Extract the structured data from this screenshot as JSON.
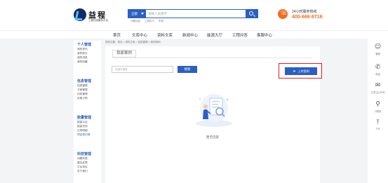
{
  "header": {
    "logo_name": "益程",
    "logo_sub": "工程在线服务平台",
    "search_select": "全部",
    "search_placeholder": "请输入关键字",
    "hotwords": [
      "问题回复",
      "工程执行",
      "申报"
    ],
    "hotline_label": "24小时服务热线",
    "hotline_number": "400-666-9716"
  },
  "nav": [
    "首页",
    "文库中心",
    "资料文库",
    "新闻中心",
    "能源大厅",
    "工程问答",
    "客服中心"
  ],
  "sidebar": {
    "groups": [
      {
        "title": "个人管理",
        "items": [
          "我的资讯",
          "我的积分",
          "我的消息",
          "我的收藏"
        ]
      },
      {
        "title": "信息管理",
        "items": [
          "信息管理",
          "方案管理",
          "问答管理",
          "优惠订购"
        ]
      },
      {
        "title": "能量管理",
        "items": [
          "能量认证",
          "能量兑现",
          "分成明细",
          "项目签约等"
        ]
      },
      {
        "title": "科技管理",
        "items": [
          "消费列表",
          "建议反馈",
          "平台协议",
          "关于我们"
        ]
      }
    ]
  },
  "breadcrumb": "您的位置：首页 > 资料文库 > 信息管理 > 我的案例",
  "panel": {
    "tab": "我家案例",
    "filter_placeholder": "关键字搜索",
    "search_label": "搜索",
    "upload_label": "上传案例",
    "empty_text": "暂无内容"
  },
  "rail": [
    {
      "icon": "robot-icon",
      "glyph": "☺",
      "label": "客服"
    },
    {
      "icon": "phone-icon",
      "glyph": "✆",
      "label": "电话"
    },
    {
      "icon": "wechat-icon",
      "glyph": "✉",
      "label": "已关注公众号"
    },
    {
      "icon": "mini-program-icon",
      "glyph": "⚲",
      "label": "小程序"
    },
    {
      "icon": "to-top-icon",
      "glyph": "⤒",
      "label": "TOP"
    }
  ],
  "colors": {
    "brand": "#2b5fc4",
    "accent": "#f26b21",
    "highlight": "#e02020"
  }
}
